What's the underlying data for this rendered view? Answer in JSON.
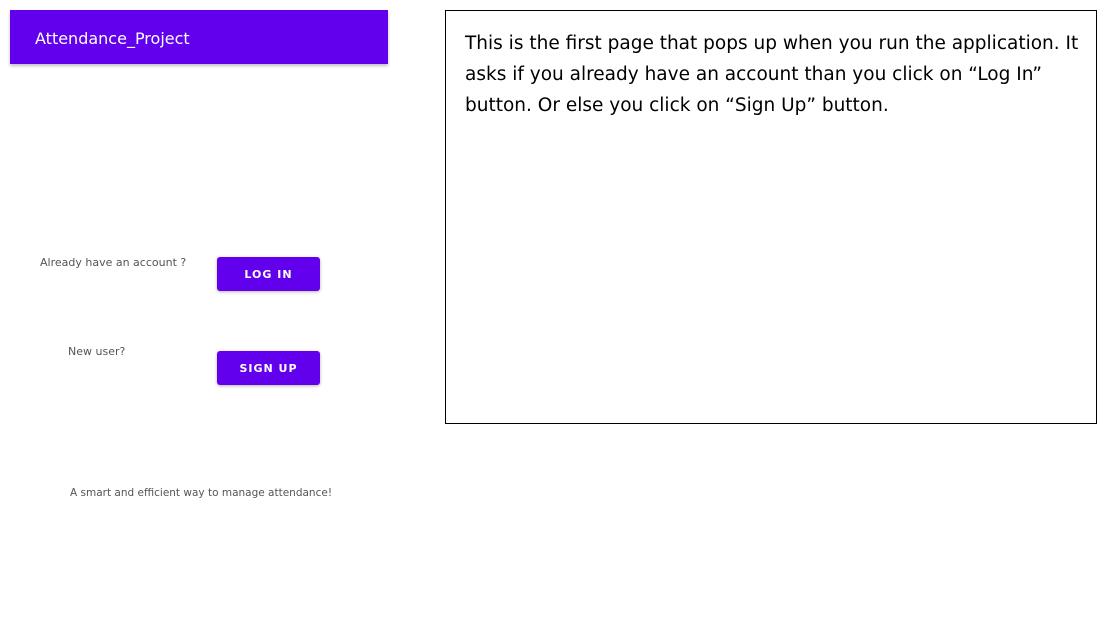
{
  "app": {
    "title": "Attendance_Project",
    "accent_color": "#6200ee"
  },
  "main": {
    "login_prompt": "Already have an account ?",
    "login_button": "LOG IN",
    "signup_prompt": "New user?",
    "signup_button": "SIGN UP",
    "tagline": "A smart and efficient way to manage attendance!"
  },
  "note": {
    "text": "This is the first page that pops up when you run the application. It asks if you already have an account than you click on “Log In” button. Or else you click on “Sign Up” button."
  }
}
